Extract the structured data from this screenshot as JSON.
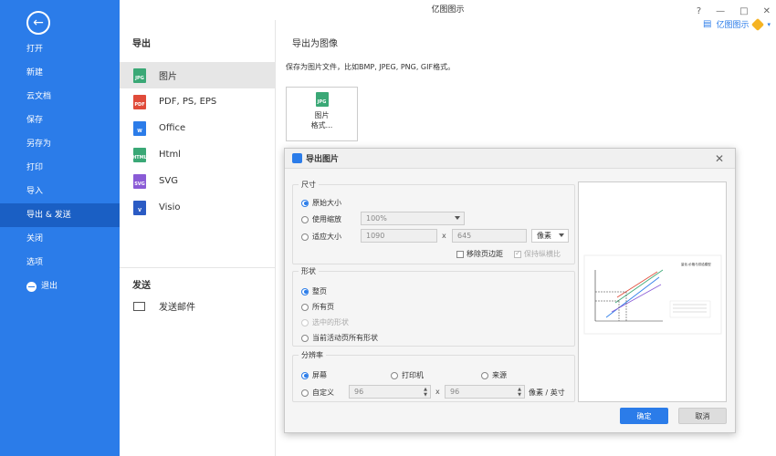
{
  "app": {
    "title": "亿图图示",
    "brand": "亿图图示"
  },
  "sidebar": {
    "items": [
      {
        "label": "打开"
      },
      {
        "label": "新建"
      },
      {
        "label": "云文档"
      },
      {
        "label": "保存"
      },
      {
        "label": "另存为"
      },
      {
        "label": "打印"
      },
      {
        "label": "导入"
      },
      {
        "label": "导出 & 发送",
        "active": true
      },
      {
        "label": "关闭"
      },
      {
        "label": "选项"
      },
      {
        "label": "退出"
      }
    ]
  },
  "export_panel": {
    "title": "导出",
    "items": [
      {
        "label": "图片",
        "icon": "JPG",
        "color": "#3aa876"
      },
      {
        "label": "PDF, PS, EPS",
        "icon": "PDF",
        "color": "#e04b3a"
      },
      {
        "label": "Office",
        "icon": "W",
        "color": "#2b7ce9"
      },
      {
        "label": "Html",
        "icon": "HTML",
        "color": "#3aa876"
      },
      {
        "label": "SVG",
        "icon": "SVG",
        "color": "#8a5bd6"
      },
      {
        "label": "Visio",
        "icon": "V",
        "color": "#2b5bc4"
      }
    ],
    "send_title": "发送",
    "send_item": "发送邮件"
  },
  "main": {
    "title": "导出为图像",
    "description": "保存为图片文件，比如BMP, JPEG, PNG, GIF格式。",
    "card_label_1": "图片",
    "card_label_2": "格式..."
  },
  "dialog": {
    "title": "导出图片",
    "size": {
      "legend": "尺寸",
      "original": "原始大小",
      "use_zoom": "使用缩放",
      "zoom_value": "100%",
      "fit_size": "适应大小",
      "width": "1090",
      "height": "645",
      "x": "x",
      "unit": "像素",
      "remove_margin": "移除页边距",
      "keep_ratio": "保持纵横比"
    },
    "shape": {
      "legend": "形状",
      "whole_page": "整页",
      "all_pages": "所有页",
      "selected": "选中的形状",
      "current_all": "当前活动页所有形状"
    },
    "resolution": {
      "legend": "分辨率",
      "screen": "屏幕",
      "printer": "打印机",
      "source": "来源",
      "custom": "自定义",
      "dpi_x": "96",
      "dpi_y": "96",
      "x": "x",
      "unit": "像素 / 英寸"
    },
    "ok": "确定",
    "cancel": "取消"
  },
  "preview_chart": {
    "title": "量化-价格与供给模型"
  }
}
